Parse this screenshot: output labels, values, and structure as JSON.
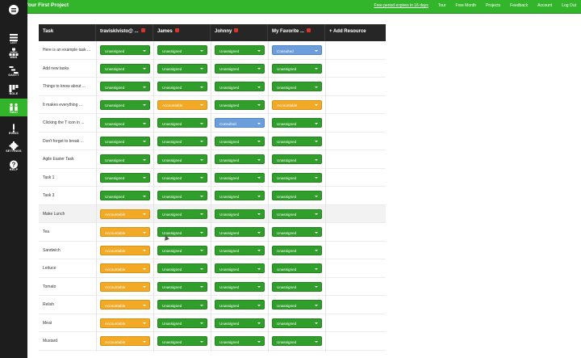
{
  "header": {
    "project_title": "Your First Project",
    "nav": [
      "Free period expires in 16 days",
      "Tour",
      "Free Month",
      "Projects",
      "Feedback",
      "Account",
      "Log Out"
    ]
  },
  "sidebar": {
    "items": [
      {
        "label": "LIST",
        "icon": "list-icon",
        "active": false
      },
      {
        "label": "WBS",
        "icon": "wbs-icon",
        "active": false
      },
      {
        "label": "GANTT",
        "icon": "gantt-icon",
        "active": false
      },
      {
        "label": "BOLE",
        "icon": "board-icon",
        "active": false
      },
      {
        "label": "RACI",
        "icon": "raci-icon",
        "active": true
      },
      {
        "label": "RISKS",
        "icon": "risks-icon",
        "active": false
      },
      {
        "label": "SETTINGS",
        "icon": "gear-icon",
        "active": false
      },
      {
        "label": "HELP",
        "icon": "help-icon",
        "active": false
      }
    ]
  },
  "grid": {
    "columns": [
      "Task",
      "travisklvisto@ ...",
      "James",
      "Johnny",
      "My Favorite ..."
    ],
    "add_resource": "+ Add Resource",
    "colors": {
      "Unassigned": "#2f9e2a",
      "Accountable": "#f2a925",
      "Consulted": "#6d9edc"
    },
    "rows": [
      {
        "task": "Here is an example task ...",
        "values": [
          "Unassigned",
          "Unassigned",
          "Unassigned",
          "Consulted"
        ]
      },
      {
        "task": "Add new tasks",
        "values": [
          "Unassigned",
          "Unassigned",
          "Unassigned",
          "Unassigned"
        ]
      },
      {
        "task": "Things to know about ...",
        "values": [
          "Unassigned",
          "Unassigned",
          "Unassigned",
          "Unassigned"
        ]
      },
      {
        "task": "It makes everything ...",
        "values": [
          "Unassigned",
          "Accountable",
          "Unassigned",
          "Accountable"
        ]
      },
      {
        "task": "Clicking the T icon in ...",
        "values": [
          "Unassigned",
          "Unassigned",
          "Consulted",
          "Unassigned"
        ]
      },
      {
        "task": "Don't forget to break ...",
        "values": [
          "Unassigned",
          "Unassigned",
          "Unassigned",
          "Unassigned"
        ]
      },
      {
        "task": "Agile Easter Task",
        "values": [
          "Unassigned",
          "Unassigned",
          "Unassigned",
          "Unassigned"
        ]
      },
      {
        "task": "Task 1",
        "values": [
          "Unassigned",
          "Unassigned",
          "Unassigned",
          "Unassigned"
        ]
      },
      {
        "task": "Task 3",
        "values": [
          "Unassigned",
          "Unassigned",
          "Unassigned",
          "Unassigned"
        ]
      },
      {
        "task": "Make Lunch",
        "values": [
          "Accountable",
          "Unassigned",
          "Unassigned",
          "Unassigned"
        ]
      },
      {
        "task": "Tea",
        "values": [
          "Accountable",
          "Unassigned",
          "Unassigned",
          "Unassigned"
        ]
      },
      {
        "task": "Sandwich",
        "values": [
          "Accountable",
          "Unassigned",
          "Unassigned",
          "Unassigned"
        ]
      },
      {
        "task": "Lettuce",
        "values": [
          "Accountable",
          "Unassigned",
          "Unassigned",
          "Unassigned"
        ]
      },
      {
        "task": "Tomato",
        "values": [
          "Accountable",
          "Unassigned",
          "Unassigned",
          "Unassigned"
        ]
      },
      {
        "task": "Relish",
        "values": [
          "Accountable",
          "Unassigned",
          "Unassigned",
          "Unassigned"
        ]
      },
      {
        "task": "Meat",
        "values": [
          "Accountable",
          "Unassigned",
          "Unassigned",
          "Unassigned"
        ]
      },
      {
        "task": "Mustard",
        "values": [
          "Accountable",
          "Unassigned",
          "Unassigned",
          "Unassigned"
        ]
      }
    ]
  }
}
